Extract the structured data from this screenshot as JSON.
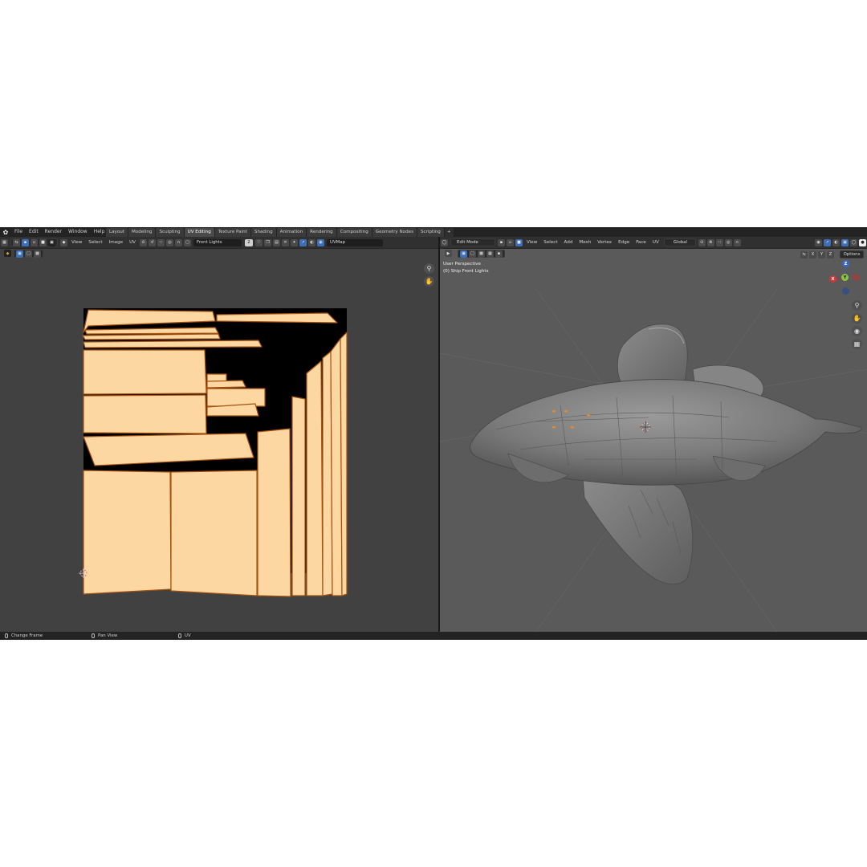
{
  "topbar": {
    "menus": [
      "File",
      "Edit",
      "Render",
      "Window",
      "Help"
    ],
    "tabs": [
      {
        "label": "Layout",
        "active": false
      },
      {
        "label": "Modeling",
        "active": false
      },
      {
        "label": "Sculpting",
        "active": false
      },
      {
        "label": "UV Editing",
        "active": true
      },
      {
        "label": "Texture Paint",
        "active": false
      },
      {
        "label": "Shading",
        "active": false
      },
      {
        "label": "Animation",
        "active": false
      },
      {
        "label": "Rendering",
        "active": false
      },
      {
        "label": "Compositing",
        "active": false
      },
      {
        "label": "Geometry Nodes",
        "active": false
      },
      {
        "label": "Scripting",
        "active": false
      }
    ],
    "add_tab": "+"
  },
  "uv_header": {
    "menus": [
      "View",
      "Select",
      "Image",
      "UV"
    ],
    "image_name": "Front Lights",
    "image_users": "2",
    "uvmap_name": "UVMap"
  },
  "viewport_header": {
    "mode": "Edit Mode",
    "menus": [
      "View",
      "Select",
      "Add",
      "Mesh",
      "Vertex",
      "Edge",
      "Face",
      "UV"
    ],
    "orientation": "Global",
    "mirror_axes": [
      "X",
      "Y",
      "Z"
    ],
    "options_label": "Options"
  },
  "viewport": {
    "perspective": "User Perspective",
    "object_name": "(0) Ship Front Lights",
    "gizmo": {
      "z": "Z",
      "y": "Y",
      "x": "X"
    }
  },
  "statusbar": {
    "left": "Change Frame",
    "middle": "Pan View",
    "right": "UV"
  },
  "colors": {
    "uv_fill": "#fdd7a2",
    "uv_edge": "#a4520f",
    "uv_background": "#414141",
    "viewport_background": "#5a5a5a",
    "accent_blue": "#3d6fb8",
    "selected_orange": "#e08a2a"
  },
  "icons": {
    "uv_zoom": "zoom-icon",
    "uv_pan": "hand-icon",
    "vp_zoom": "zoom-icon",
    "vp_pan": "hand-icon",
    "vp_camera": "camera-icon",
    "vp_ortho": "grid-icon"
  }
}
